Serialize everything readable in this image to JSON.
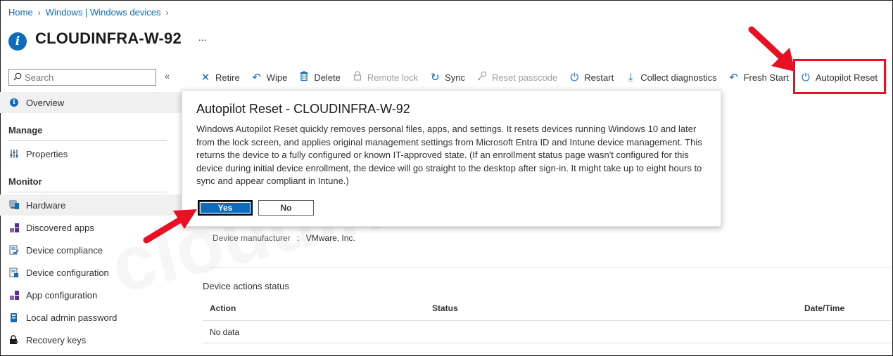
{
  "breadcrumb": [
    "Home",
    "Windows | Windows devices"
  ],
  "title": "CLOUDINFRA-W-92",
  "more_label": "...",
  "search": {
    "placeholder": "Search"
  },
  "collapse_label": "«",
  "sidebar": {
    "overview": "Overview",
    "manage_heading": "Manage",
    "properties": "Properties",
    "monitor_heading": "Monitor",
    "items": [
      {
        "label": "Hardware",
        "icon": "hardware-icon"
      },
      {
        "label": "Discovered apps",
        "icon": "apps-icon"
      },
      {
        "label": "Device compliance",
        "icon": "compliance-icon"
      },
      {
        "label": "Device configuration",
        "icon": "configuration-icon"
      },
      {
        "label": "App configuration",
        "icon": "app-config-icon"
      },
      {
        "label": "Local admin password",
        "icon": "password-icon"
      },
      {
        "label": "Recovery keys",
        "icon": "lock-icon"
      }
    ]
  },
  "toolbar": {
    "retire": "Retire",
    "wipe": "Wipe",
    "delete": "Delete",
    "remote_lock": "Remote lock",
    "sync": "Sync",
    "reset_passcode": "Reset passcode",
    "restart": "Restart",
    "collect_diagnostics": "Collect diagnostics",
    "fresh_start": "Fresh Start",
    "autopilot_reset": "Autopilot Reset"
  },
  "dialog": {
    "title": "Autopilot Reset - CLOUDINFRA-W-92",
    "body": "Windows Autopilot Reset quickly removes personal files, apps, and settings. It resets devices running Windows 10 and later from the lock screen, and applies original management settings from Microsoft Entra ID and Intune device management. This returns the device to a fully configured or known IT-approved state. (If an enrollment status page wasn't configured for this device during initial device enrollment, the device will go straight to the desktop after sign-in. It might take up to eight hours to sync and appear compliant in Intune.)",
    "yes": "Yes",
    "no": "No"
  },
  "details": {
    "manufacturer_label": "Device manufacturer",
    "separator": ":",
    "manufacturer_value": "VMware, Inc."
  },
  "actions_status": {
    "heading": "Device actions status",
    "columns": [
      "Action",
      "Status",
      "Date/Time"
    ],
    "empty": "No data"
  },
  "watermark": "cloudinfra.net",
  "colors": {
    "accent": "#0f6cbd",
    "highlight": "#e81123",
    "arrow": "#e81123"
  }
}
